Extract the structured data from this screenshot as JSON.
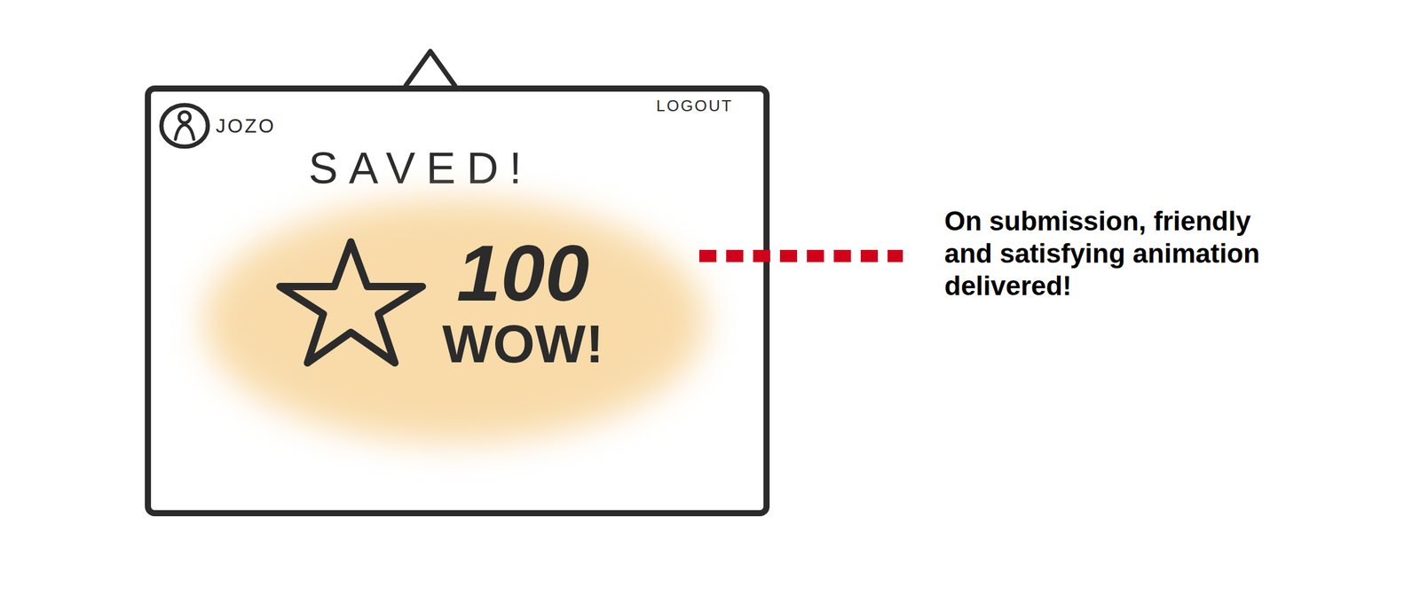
{
  "header": {
    "user": "JOZO",
    "logout": "LOGOUT"
  },
  "message": {
    "title": "SAVED!",
    "points": "100",
    "exclaim": "WOW!"
  },
  "annotation": {
    "lines": [
      "On submission, friendly",
      "and satisfying animation",
      "delivered!"
    ]
  }
}
